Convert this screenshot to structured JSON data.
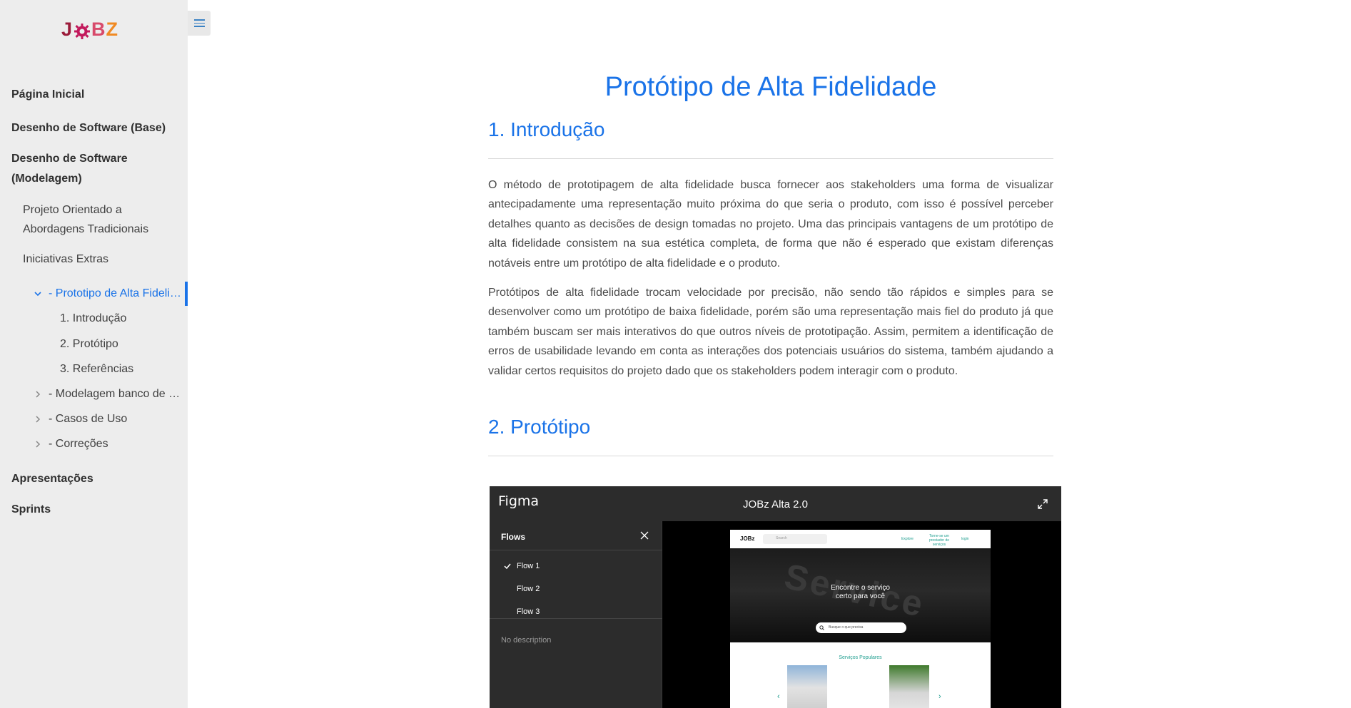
{
  "sidebar": {
    "logo": {
      "j": "J",
      "o": "O",
      "b": "B",
      "z": "Z"
    },
    "items": [
      {
        "label": "Página Inicial"
      },
      {
        "label": "Desenho de Software (Base)"
      },
      {
        "label": "Desenho de Software (Modelagem)"
      }
    ],
    "subitems": [
      {
        "label": "Projeto Orientado a Abordagens Tradicionais"
      },
      {
        "label": "Iniciativas Extras"
      }
    ],
    "tree": [
      {
        "label": "- Prototipo de Alta Fideli…",
        "active": true,
        "expanded": true
      },
      {
        "label": "- Modelagem banco de …"
      },
      {
        "label": "- Casos de Uso"
      },
      {
        "label": "- Correções"
      }
    ],
    "toc": [
      {
        "label": "1. Introdução"
      },
      {
        "label": "2. Protótipo"
      },
      {
        "label": "3. Referências"
      }
    ],
    "bottom_items": [
      {
        "label": "Apresentações"
      },
      {
        "label": "Sprints"
      }
    ]
  },
  "main": {
    "title": "Protótipo de Alta Fidelidade",
    "sections": [
      {
        "heading": "1. Introdução"
      },
      {
        "heading": "2. Protótipo"
      }
    ],
    "paragraphs": [
      "O método de prototipagem de alta fidelidade busca fornecer aos stakeholders uma forma de visualizar antecipadamente uma representação muito próxima do que seria o produto, com isso é possível perceber detalhes quanto as decisões de design tomadas no projeto. Uma das principais vantagens de um protótipo de alta fidelidade consistem na sua estética completa, de forma que não é esperado que existam diferenças notáveis entre um protótipo de alta fidelidade e o produto.",
      "Protótipos de alta fidelidade trocam velocidade por precisão, não sendo tão rápidos e simples para se desenvolver como um protótipo de baixa fidelidade, porém são uma representação mais fiel do produto já que também buscam ser mais interativos do que outros níveis de prototipação. Assim, permitem a identificação de erros de usabilidade levando em conta as interações dos potenciais usuários do sistema, também ajudando a validar certos requisitos do projeto dado que os stakeholders podem interagir com o produto."
    ]
  },
  "figma": {
    "logo": "Figma",
    "title": "JOBz Alta 2.0",
    "flows_label": "Flows",
    "flows": [
      "Flow 1",
      "Flow 2",
      "Flow 3"
    ],
    "selected_flow": "Flow 1",
    "no_description": "No description",
    "frame": {
      "logo": "JOBz",
      "search_placeholder": "Search",
      "links": [
        "Explore",
        "Torne-se um prestador de serviços",
        "login"
      ],
      "hero_bg": "Service",
      "hero_title": "Encontre o serviço certo para você",
      "hero_search": "Busque o que precisa",
      "popular": "Serviços Populares"
    }
  },
  "colors": {
    "accent": "#1a73e8",
    "sidebar_bg": "#ededed",
    "figma_bg": "#1e1e1e",
    "teal": "#1f9e8f"
  }
}
